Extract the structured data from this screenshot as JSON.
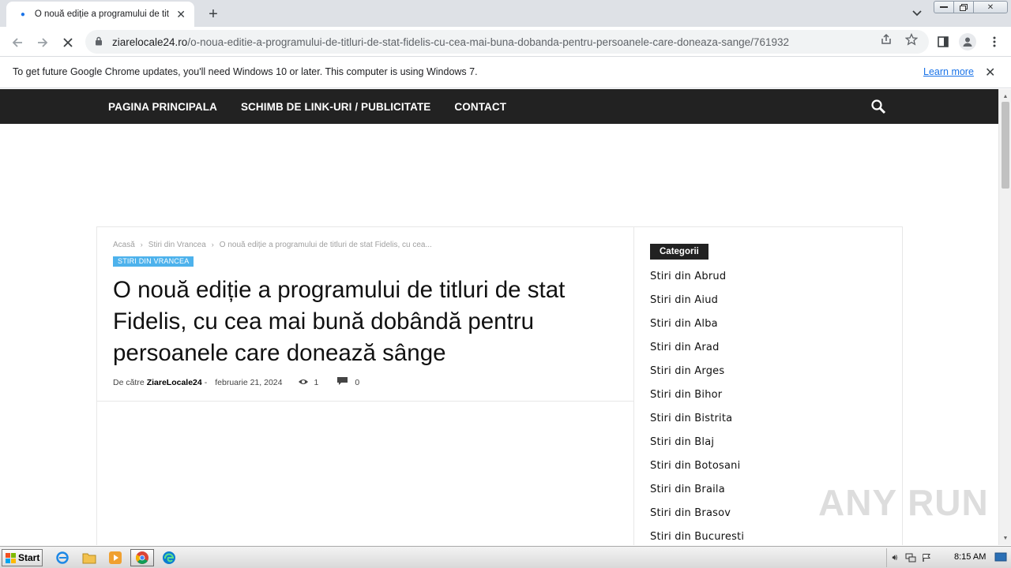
{
  "browser": {
    "tab_title": "O nouă ediție a programului de titluri de stat Fidelis, cu cea mai bună dobândă",
    "url_host": "ziarelocale24.ro",
    "url_path": "/o-noua-editie-a-programului-de-titluri-de-stat-fidelis-cu-cea-mai-buna-dobanda-pentru-persoanele-care-doneaza-sange/761932",
    "infobar_message": "To get future Google Chrome updates, you'll need Windows 10 or later. This computer is using Windows 7.",
    "infobar_link": "Learn more"
  },
  "site": {
    "nav": [
      "PAGINA PRINCIPALA",
      "SCHIMB DE LINK-URI / PUBLICITATE",
      "CONTACT"
    ]
  },
  "article": {
    "breadcrumb": [
      "Acasă",
      "Stiri din Vrancea",
      "O nouă ediție a programului de titluri de stat Fidelis, cu cea..."
    ],
    "category": "STIRI DIN VRANCEA",
    "title": "O nouă ediție a programului de titluri de stat Fidelis, cu cea mai bună dobândă pentru persoanele care donează sânge",
    "by_label": "De către",
    "author": "ZiareLocale24",
    "author_sep": "-",
    "date": "februarie 21, 2024",
    "views": "1",
    "comments": "0"
  },
  "sidebar": {
    "title": "Categorii",
    "items": [
      "Stiri din Abrud",
      "Stiri din Aiud",
      "Stiri din Alba",
      "Stiri din Arad",
      "Stiri din Arges",
      "Stiri din Bihor",
      "Stiri din Bistrita",
      "Stiri din Blaj",
      "Stiri din Botosani",
      "Stiri din Braila",
      "Stiri din Brasov",
      "Stiri din Bucuresti"
    ]
  },
  "watermark": "ANY RUN",
  "taskbar": {
    "start_label": "Start",
    "clock": "8:15 AM"
  },
  "colors": {
    "nav_bg": "#222222",
    "category_tag": "#4db2ec",
    "link_blue": "#1a73e8"
  }
}
